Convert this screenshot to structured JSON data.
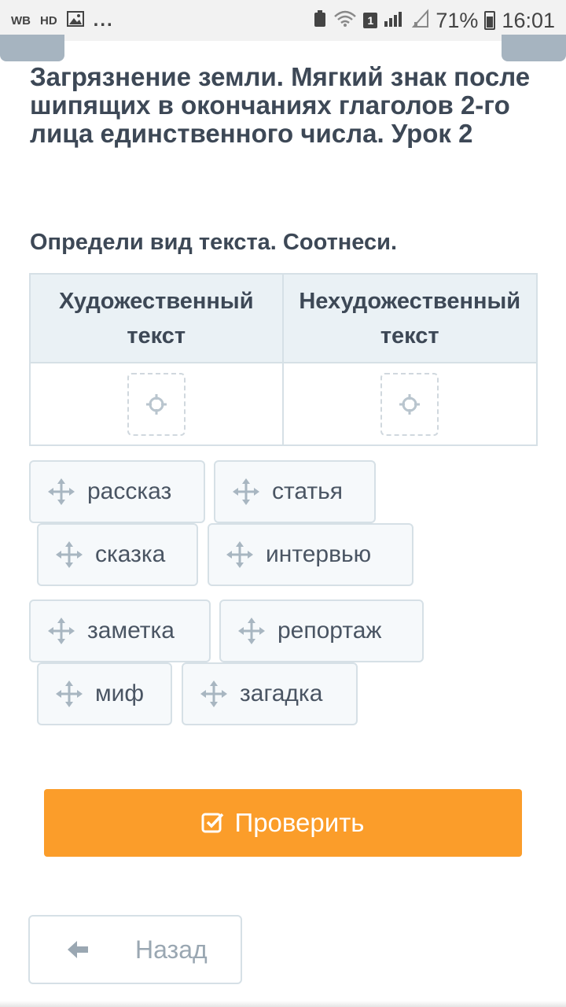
{
  "status_bar": {
    "left_items": [
      "WB",
      "HD"
    ],
    "more": "...",
    "sim_number": "1",
    "battery": "71%",
    "time": "16:01"
  },
  "lesson": {
    "title": "Загрязнение земли. Мягкий знак после шипящих в окончаниях глаголов 2-го лица единственного числа. Урок 2"
  },
  "task": {
    "instruction": "Определи вид текста. Соотнеси.",
    "columns": [
      {
        "header": "Художественный текст"
      },
      {
        "header": "Нехудожественный текст"
      }
    ],
    "chips": [
      {
        "label": "рассказ"
      },
      {
        "label": "статья"
      },
      {
        "label": "сказка"
      },
      {
        "label": "интервью"
      },
      {
        "label": "заметка"
      },
      {
        "label": "репортаж"
      },
      {
        "label": "миф"
      },
      {
        "label": "загадка"
      }
    ]
  },
  "actions": {
    "check_label": "Проверить",
    "back_label": "Назад"
  },
  "colors": {
    "accent": "#fb9d2a",
    "text": "#3d4856",
    "border": "#d6e0e6",
    "header_bg": "#eaf1f5"
  }
}
